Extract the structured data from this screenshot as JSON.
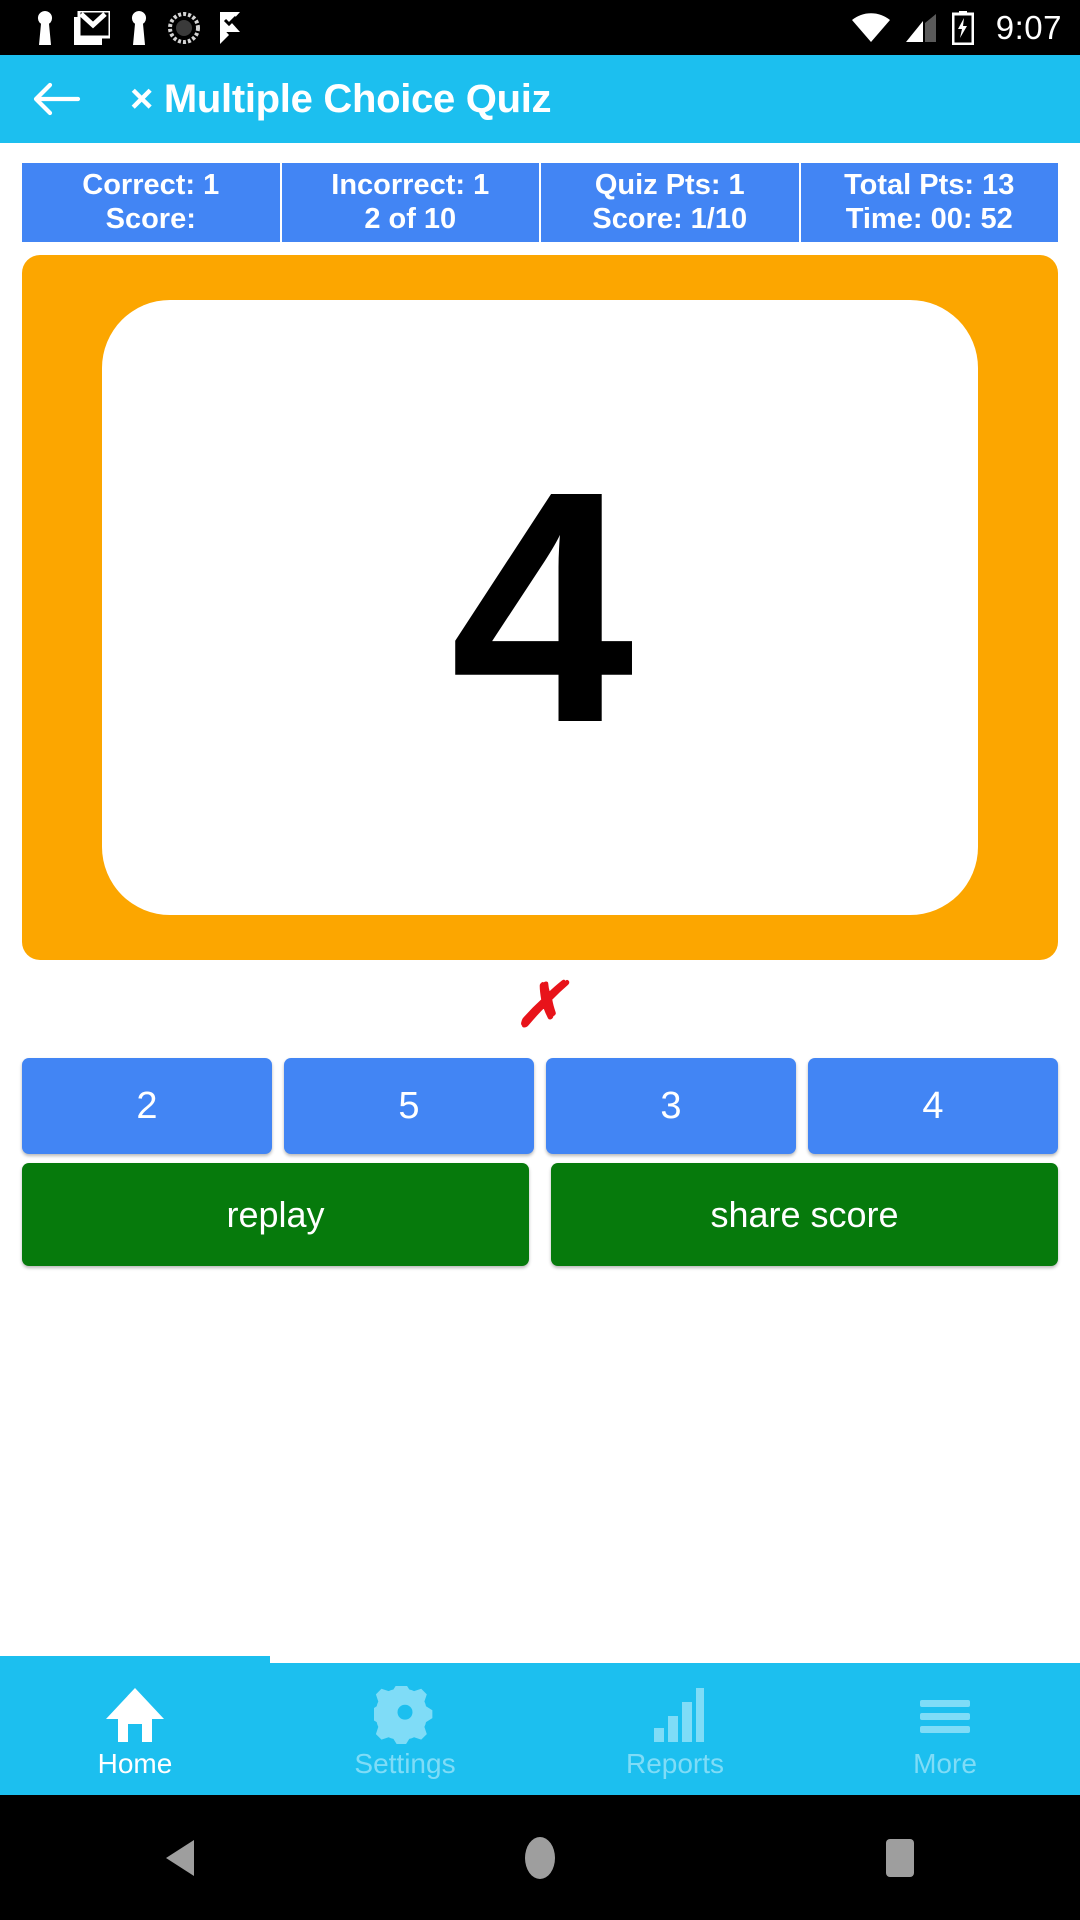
{
  "status_bar": {
    "clock": "9:07",
    "left_icons": [
      "keyhole-icon",
      "gmail-icon",
      "keyhole-icon",
      "sync-spinner-icon",
      "checkmark-flag-icon"
    ],
    "right_icons": [
      "wifi-icon",
      "cell-signal-icon",
      "battery-charging-icon"
    ]
  },
  "app_bar": {
    "back_icon": "back-arrow-icon",
    "title": "× Multiple Choice Quiz"
  },
  "score_bar": {
    "columns": [
      {
        "top": "Correct:  1",
        "bottom": "Score:"
      },
      {
        "top": "Incorrect:  1",
        "bottom": "2 of 10"
      },
      {
        "top": "Quiz Pts: 1",
        "bottom": "Score:  1/10"
      },
      {
        "top": "Total Pts: 13",
        "bottom": "Time:   00: 52"
      }
    ]
  },
  "question_card": {
    "value": "4",
    "card_color": "#FCA600",
    "inner_color": "#FFFFFF"
  },
  "result": {
    "mark": "✗",
    "color": "#E8131A"
  },
  "answers": {
    "options": [
      "2",
      "5",
      "3",
      "4"
    ],
    "color": "#4285F4"
  },
  "actions": {
    "buttons": [
      "replay",
      "share score"
    ],
    "color": "#067A0C"
  },
  "tab_bar": {
    "tabs": [
      {
        "label": "Home",
        "icon": "home-icon",
        "active": true
      },
      {
        "label": "Settings",
        "icon": "gear-icon",
        "active": false
      },
      {
        "label": "Reports",
        "icon": "bar-chart-icon",
        "active": false
      },
      {
        "label": "More",
        "icon": "hamburger-menu-icon",
        "active": false
      }
    ],
    "bar_color": "#1CBFEF"
  },
  "nav_bar": {
    "buttons": [
      "back-triangle-icon",
      "home-circle-icon",
      "recents-square-icon"
    ]
  }
}
